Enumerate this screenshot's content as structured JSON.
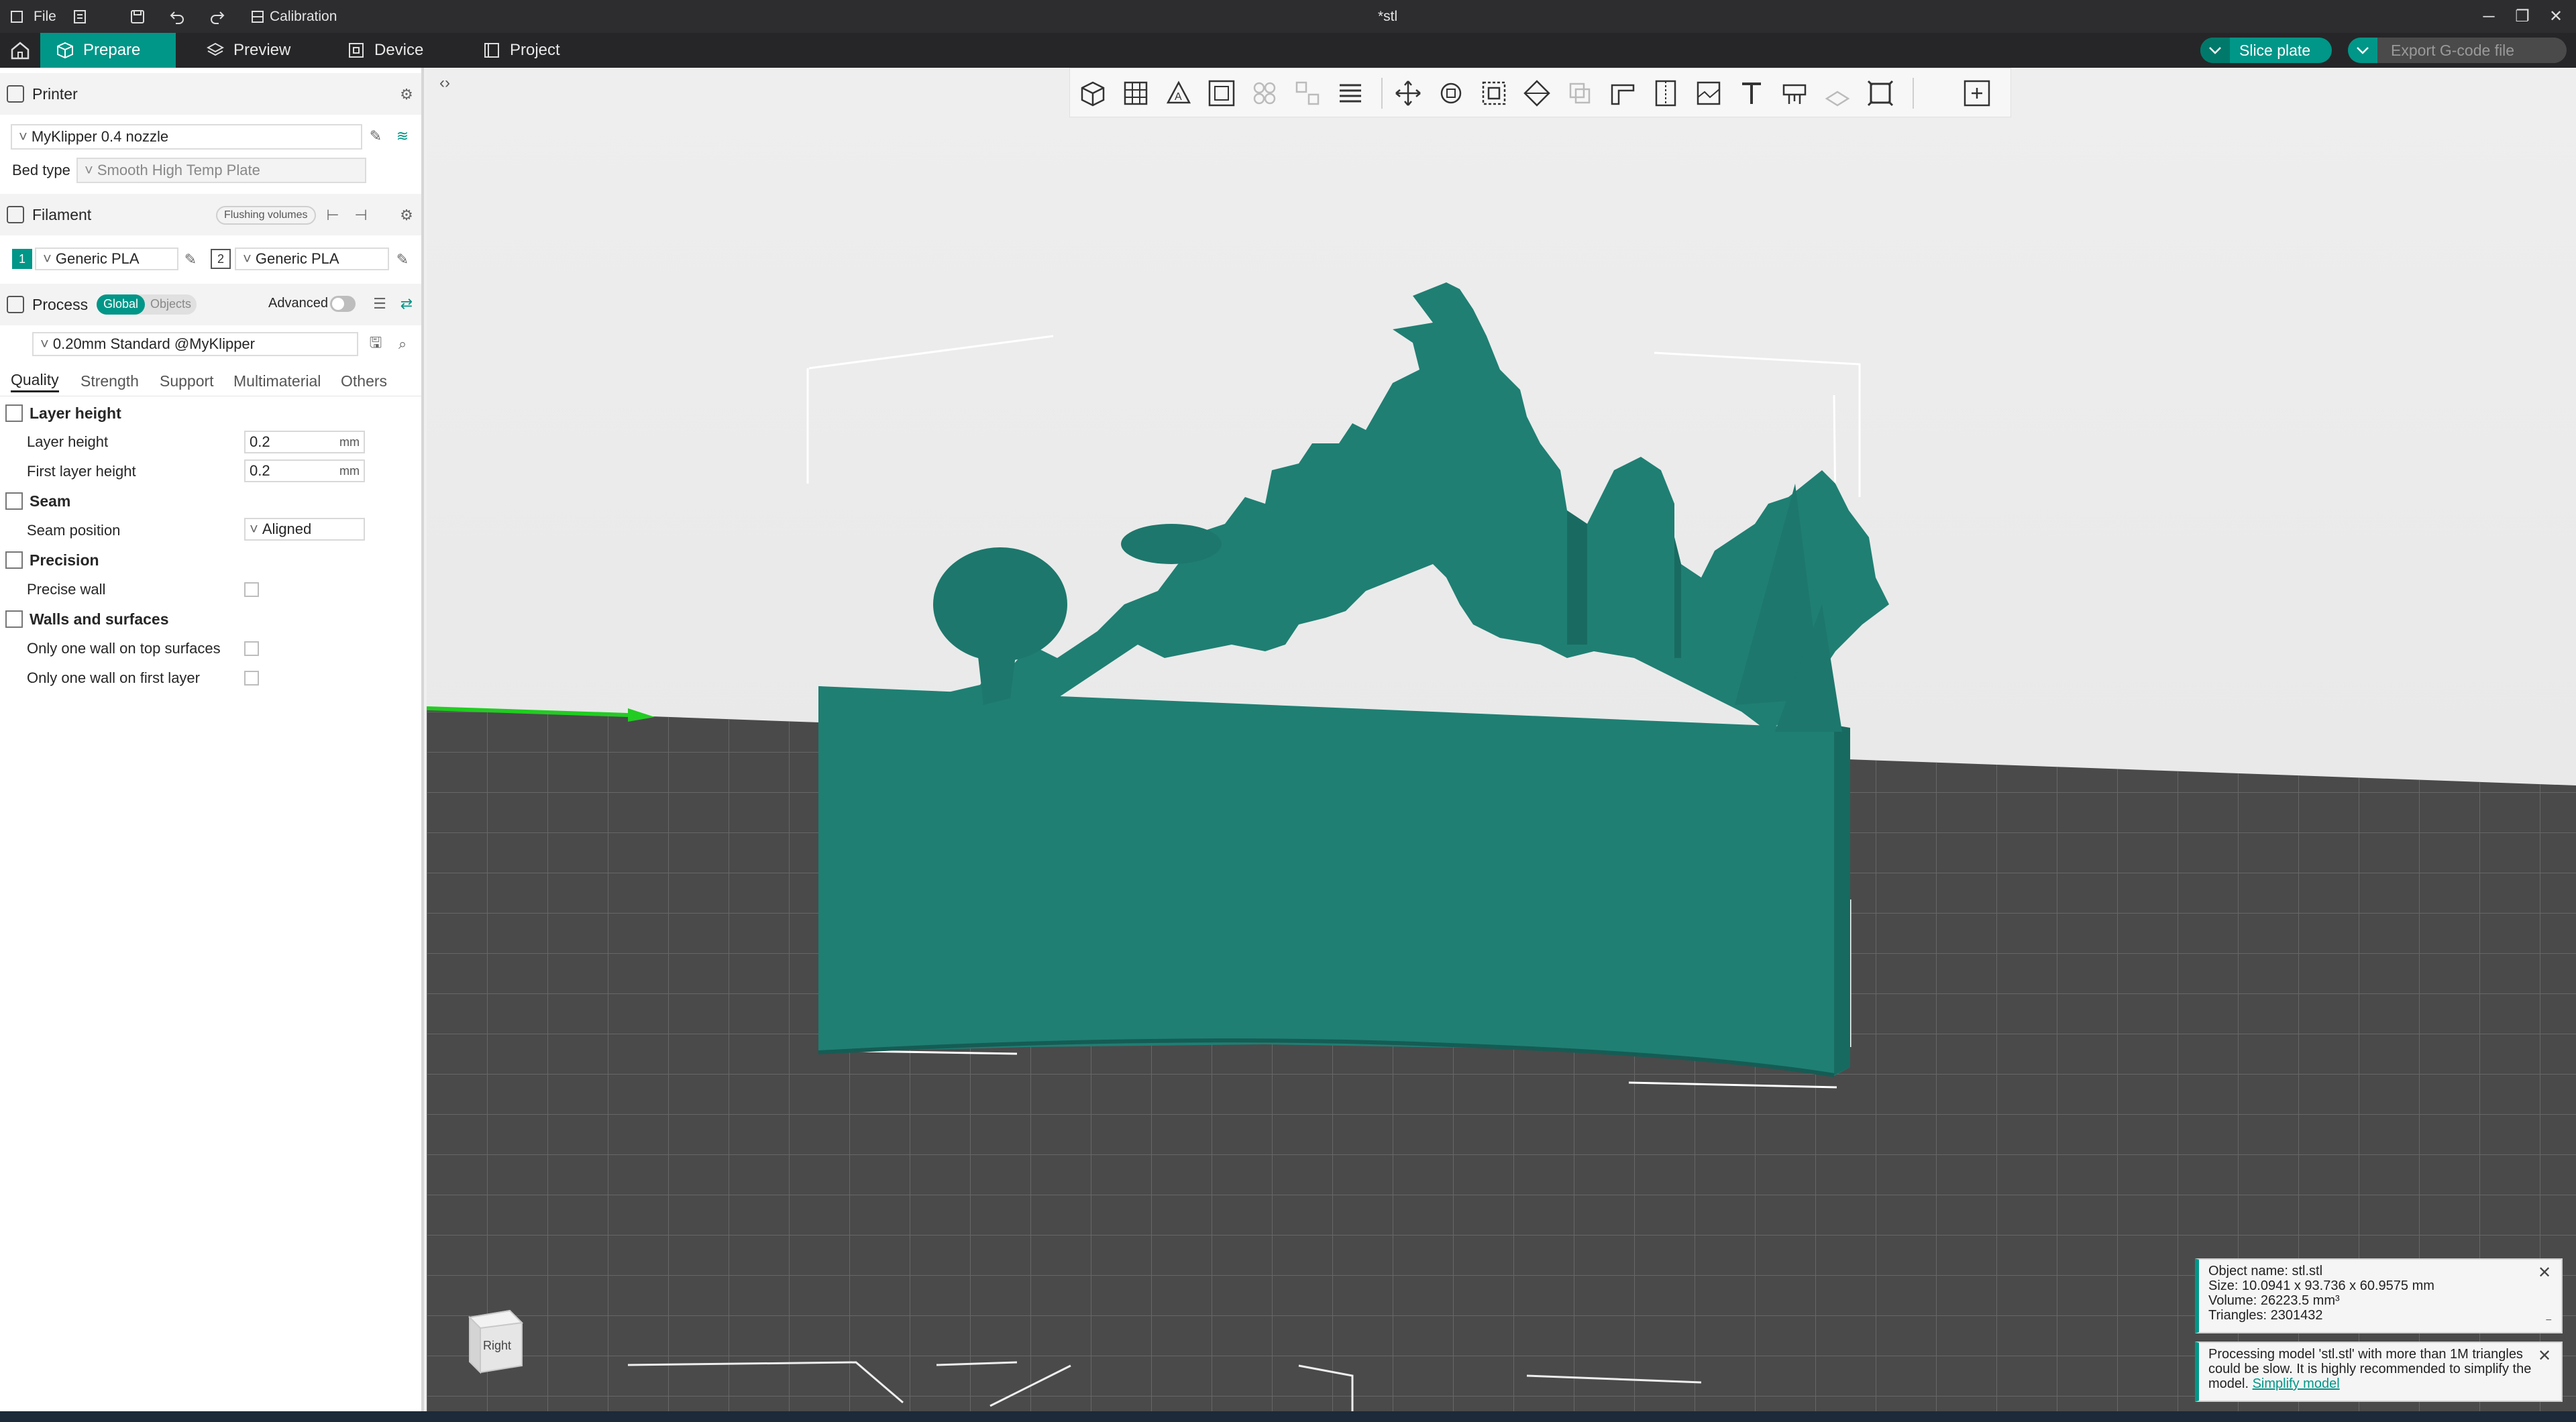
{
  "titlebar": {
    "file_label": "File",
    "calibration_label": "Calibration",
    "doc_title": "*stl"
  },
  "tabs": [
    {
      "label": "Prepare",
      "icon": "cube-icon",
      "active": true
    },
    {
      "label": "Preview",
      "icon": "layers-icon",
      "active": false
    },
    {
      "label": "Device",
      "icon": "device-icon",
      "active": false
    },
    {
      "label": "Project",
      "icon": "project-icon",
      "active": false
    }
  ],
  "actions": {
    "slice_label": "Slice plate",
    "export_label": "Export G-code file"
  },
  "printer": {
    "header": "Printer",
    "name": "MyKlipper 0.4 nozzle",
    "bed_label": "Bed type",
    "bed_value": "Smooth High Temp Plate"
  },
  "filament": {
    "header": "Filament",
    "flushing_label": "Flushing volumes",
    "slots": [
      {
        "num": "1",
        "name": "Generic PLA",
        "color": "#009688"
      },
      {
        "num": "2",
        "name": "Generic PLA",
        "color": "#ffffff"
      }
    ]
  },
  "process": {
    "header": "Process",
    "global_label": "Global",
    "objects_label": "Objects",
    "advanced_label": "Advanced",
    "preset": "0.20mm Standard @MyKlipper",
    "tabs": [
      "Quality",
      "Strength",
      "Support",
      "Multimaterial",
      "Others"
    ]
  },
  "quality": {
    "layer_group": "Layer height",
    "layer_height_label": "Layer height",
    "layer_height_value": "0.2",
    "first_layer_label": "First layer height",
    "first_layer_value": "0.2",
    "unit": "mm",
    "seam_group": "Seam",
    "seam_pos_label": "Seam position",
    "seam_pos_value": "Aligned",
    "precision_group": "Precision",
    "precise_wall_label": "Precise wall",
    "walls_group": "Walls and surfaces",
    "one_wall_top_label": "Only one wall on top surfaces",
    "one_wall_first_label": "Only one wall on first layer"
  },
  "viewport": {
    "view_cube_label": "Right",
    "model_color": "#1f7f73"
  },
  "notifications": {
    "object_name": "Object name: stl.stl",
    "size": "Size: 10.0941 x 93.736 x 60.9575 mm",
    "volume": "Volume: 26223.5 mm³",
    "triangles": "Triangles: 2301432",
    "processing_text": "Processing model 'stl.stl' with more than 1M triangles could be slow. It is highly recommended to simplify the model.",
    "simplify_link": "Simplify model"
  },
  "colors": {
    "accent": "#009688",
    "titlebar": "#2d2d30",
    "tabbar": "#262628"
  }
}
